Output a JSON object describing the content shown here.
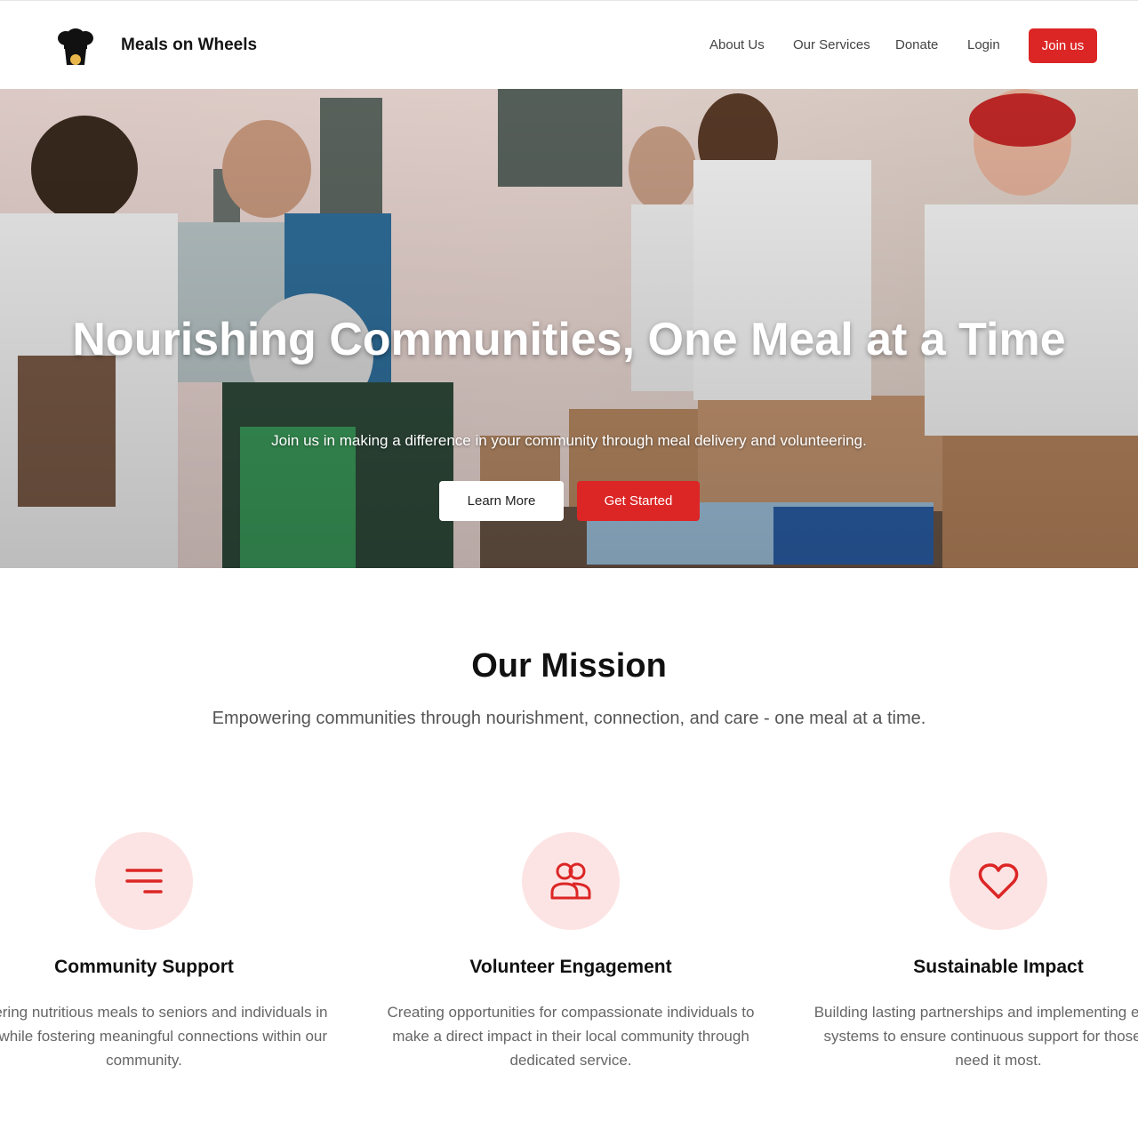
{
  "header": {
    "brand": "Meals on Wheels",
    "nav": [
      "About Us",
      "Our Services",
      "Donate",
      "Login"
    ],
    "join_label": "Join us",
    "logo_icon": "chef-hat-icon"
  },
  "hero": {
    "title": "Nourishing Communities, One Meal at a Time",
    "subtitle": "Join us in making a difference in your community through meal delivery and volunteering.",
    "learn_more": "Learn More",
    "get_started": "Get Started"
  },
  "mission": {
    "title": "Our Mission",
    "subtitle": "Empowering communities through nourishment, connection, and care - one meal at a time.",
    "features": [
      {
        "icon": "menu-lines-icon",
        "title": "Community Support",
        "desc": "Delivering nutritious meals to seniors and individuals in need while fostering meaningful connections within our community."
      },
      {
        "icon": "people-icon",
        "title": "Volunteer Engagement",
        "desc": "Creating opportunities for compassionate individuals to make a direct impact in their local community through dedicated service."
      },
      {
        "icon": "heart-icon",
        "title": "Sustainable Impact",
        "desc": "Building lasting partnerships and implementing efficient systems to ensure continuous support for those who need it most."
      }
    ]
  },
  "colors": {
    "accent": "#dc2626",
    "icon_bg": "#fde4e4"
  }
}
